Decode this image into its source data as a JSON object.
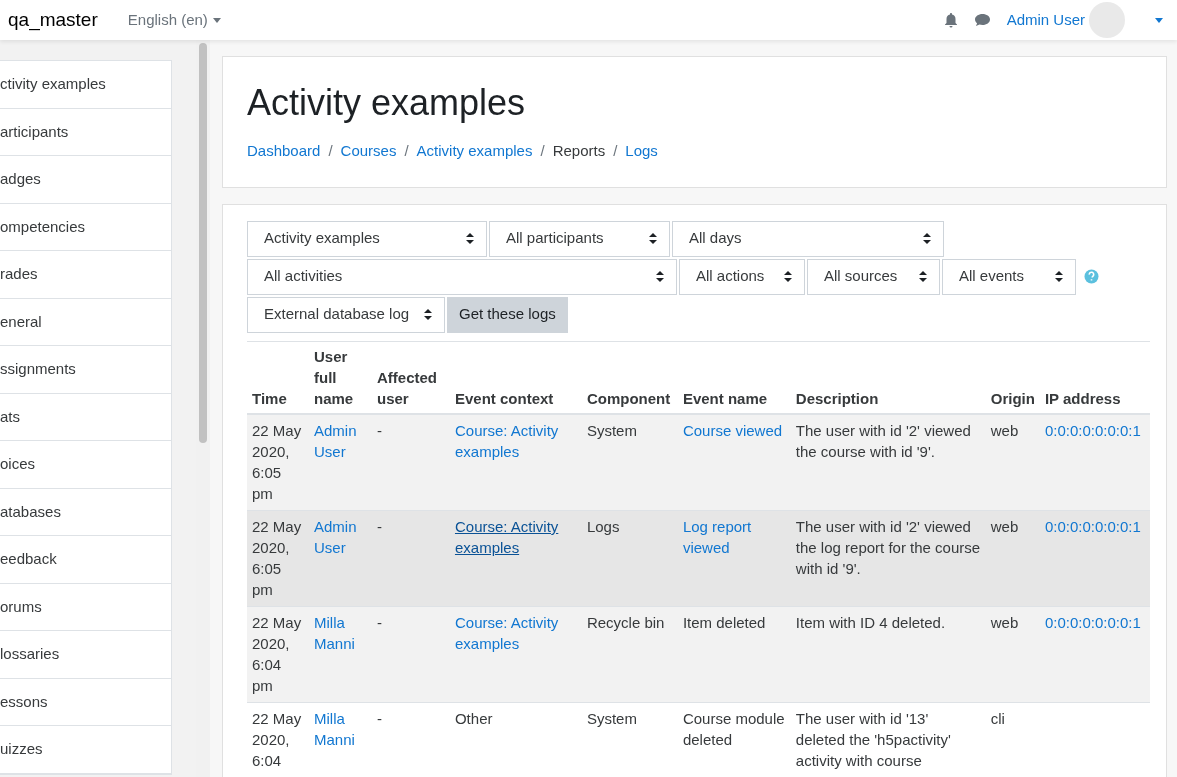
{
  "navbar": {
    "site_name": "qa_master",
    "language": "English (en)",
    "user_name": "Admin User"
  },
  "sidebar": {
    "items": [
      {
        "label": "ctivity examples"
      },
      {
        "label": "articipants"
      },
      {
        "label": "adges"
      },
      {
        "label": "ompetencies"
      },
      {
        "label": "rades"
      },
      {
        "label": "eneral"
      },
      {
        "label": "ssignments"
      },
      {
        "label": "ats"
      },
      {
        "label": "oices"
      },
      {
        "label": "atabases"
      },
      {
        "label": "eedback"
      },
      {
        "label": "orums"
      },
      {
        "label": "lossaries"
      },
      {
        "label": "essons"
      },
      {
        "label": "uizzes"
      }
    ]
  },
  "header": {
    "title": "Activity examples",
    "separator": "/",
    "breadcrumb": [
      {
        "label": "Dashboard",
        "kind": "link"
      },
      {
        "label": "Courses",
        "kind": "link"
      },
      {
        "label": "Activity examples",
        "kind": "link"
      },
      {
        "label": "Reports",
        "kind": "text"
      },
      {
        "label": "Logs",
        "kind": "link"
      }
    ]
  },
  "filters": {
    "selects": [
      "Activity examples",
      "All participants",
      "All days",
      "All activities",
      "All actions",
      "All sources",
      "All events",
      "External database log"
    ],
    "submit": "Get these logs"
  },
  "table": {
    "columns": [
      "Time",
      "User full name",
      "Affected user",
      "Event context",
      "Component",
      "Event name",
      "Description",
      "Origin",
      "IP address"
    ],
    "rows": [
      {
        "time": "22 May 2020, 6:05 pm",
        "user": "Admin User",
        "affected": "-",
        "context": "Course: Activity examples",
        "context_link": true,
        "context_hover": false,
        "component": "System",
        "event": "Course viewed",
        "event_link": true,
        "description": "The user with id '2' viewed the course with id '9'.",
        "origin": "web",
        "ip": "0:0:0:0:0:0:0:1",
        "hovered": false
      },
      {
        "time": "22 May 2020, 6:05 pm",
        "user": "Admin User",
        "affected": "-",
        "context": "Course: Activity examples",
        "context_link": true,
        "context_hover": true,
        "component": "Logs",
        "event": "Log report viewed",
        "event_link": true,
        "description": "The user with id '2' viewed the log report for the course with id '9'.",
        "origin": "web",
        "ip": "0:0:0:0:0:0:0:1",
        "hovered": true
      },
      {
        "time": "22 May 2020, 6:04 pm",
        "user": "Milla Manni",
        "affected": "-",
        "context": "Course: Activity examples",
        "context_link": true,
        "context_hover": false,
        "component": "Recycle bin",
        "event": "Item deleted",
        "event_link": false,
        "description": "Item with ID 4 deleted.",
        "origin": "web",
        "ip": "0:0:0:0:0:0:0:1",
        "hovered": false
      },
      {
        "time": "22 May 2020, 6:04",
        "user": "Milla Manni",
        "affected": "-",
        "context": "Other",
        "context_link": false,
        "context_hover": false,
        "component": "System",
        "event": "Course module deleted",
        "event_link": false,
        "description": "The user with id '13' deleted the 'h5pactivity' activity with course",
        "origin": "cli",
        "hovered": false
      }
    ]
  }
}
